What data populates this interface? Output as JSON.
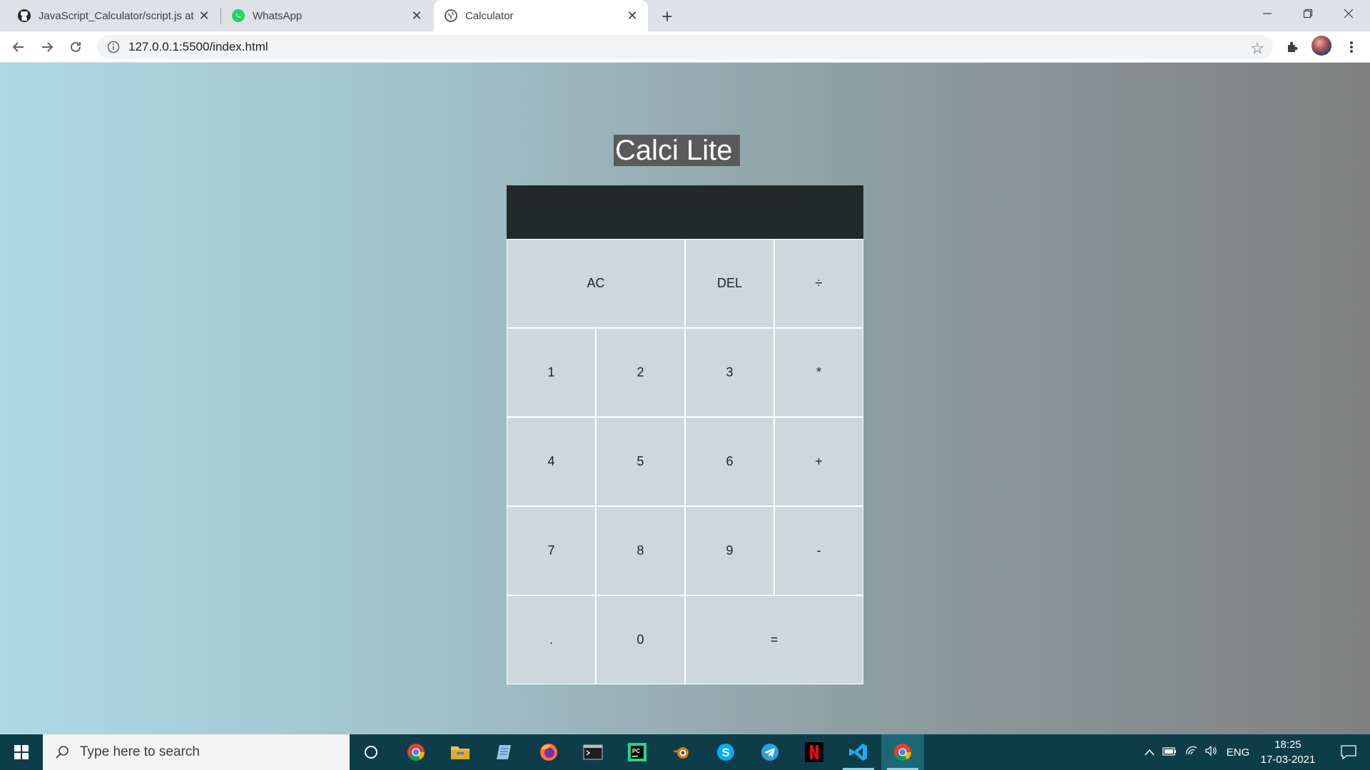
{
  "browser": {
    "tabs": [
      {
        "title": "JavaScript_Calculator/script.js at",
        "icon": "github-icon"
      },
      {
        "title": "WhatsApp",
        "icon": "whatsapp-icon"
      },
      {
        "title": "Calculator",
        "icon": "globe-icon",
        "active": true
      }
    ],
    "url": "127.0.0.1:5500/index.html"
  },
  "calculator": {
    "title": "Calci Lite",
    "display": {
      "previous": "",
      "current": ""
    },
    "keys": {
      "ac": "AC",
      "del": "DEL",
      "divide": "÷",
      "k1": "1",
      "k2": "2",
      "k3": "3",
      "multiply": "*",
      "k4": "4",
      "k5": "5",
      "k6": "6",
      "plus": "+",
      "k7": "7",
      "k8": "8",
      "k9": "9",
      "minus": "-",
      "dot": ".",
      "k0": "0",
      "equals": "="
    }
  },
  "taskbar": {
    "search_placeholder": "Type here to search",
    "language": "ENG",
    "time": "18:25",
    "date": "17-03-2021",
    "apps": [
      "cortana-icon",
      "chrome-icon",
      "file-explorer-icon",
      "notepad-icon",
      "firefox-icon",
      "terminal-icon",
      "pycharm-icon",
      "blender-icon",
      "skype-icon",
      "telegram-icon",
      "netflix-icon",
      "vscode-icon",
      "chrome-icon"
    ]
  },
  "colors": {
    "page_gradient_start": "#aed9e6",
    "page_gradient_end": "#808080",
    "display_bg": "#23292b",
    "key_bg": "#ccd8dc",
    "title_bg": "#5a5a5a",
    "taskbar_bg": "#0e3d4a"
  }
}
